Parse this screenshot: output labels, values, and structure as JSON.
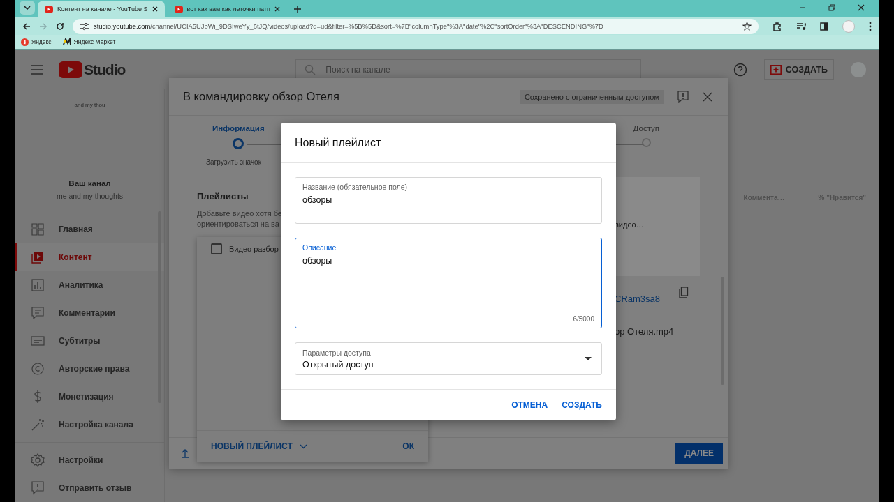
{
  "browser": {
    "tabs": [
      {
        "title": "Контент на канале - YouTube S",
        "selected": true
      },
      {
        "title": "вот как вам как леточки патп",
        "selected": false
      }
    ],
    "url_host": "studio.youtube.com",
    "url_path": "/channel/UCIA5UJbWi_9DSIweYy_6tJQ/videos/upload?d=ud&filter=%5B%5D&sort=%7B\"columnType\"%3A\"date\"%2C\"sortOrder\"%3A\"DESCENDING\"%7D",
    "bookmarks": [
      {
        "label": "Яндекс"
      },
      {
        "label": "Яндекс Маркет"
      }
    ]
  },
  "header": {
    "logo": "Studio",
    "search_placeholder": "Поиск на канале",
    "create_button": "СОЗДАТЬ"
  },
  "sidebar": {
    "channel_top": "and my thou",
    "channel_label": "Ваш канал",
    "channel_name": "me and my thoughts",
    "items": [
      {
        "label": "Главная",
        "selected": false
      },
      {
        "label": "Контент",
        "selected": true
      },
      {
        "label": "Аналитика",
        "selected": false
      },
      {
        "label": "Комментарии",
        "selected": false
      },
      {
        "label": "Субтитры",
        "selected": false
      },
      {
        "label": "Авторские права",
        "selected": false
      },
      {
        "label": "Монетизация",
        "selected": false
      },
      {
        "label": "Настройка канала",
        "selected": false
      }
    ],
    "bottom_items": [
      {
        "label": "Настройки"
      },
      {
        "label": "Отправить отзыв"
      }
    ]
  },
  "table": {
    "columns": [
      "Коммента…",
      "% \"Нравится\""
    ]
  },
  "upload_dialog": {
    "title": "В командировку обзор Отеля",
    "save_status": "Сохранено с ограниченным доступом",
    "steps": [
      {
        "label": "Информация",
        "selected": true
      },
      {
        "label": "Доступ",
        "selected": false
      }
    ],
    "upload_thumbnail": "Загрузить значок",
    "playlists_heading": "Плейлисты",
    "playlists_hint_lines": [
      "Добавьте видео хотя бе",
      "ориентироваться на ва"
    ],
    "preview_text": "видео…",
    "video_link": "CRam3sa8",
    "filename": "ор Отеля.mp4",
    "next_button": "ДАЛЕЕ"
  },
  "playlist_popover": {
    "items": [
      {
        "label": "Видео разбор",
        "checked": false
      }
    ],
    "new_button": "НОВЫЙ ПЛЕЙЛИСТ",
    "ok_button": "ОК"
  },
  "new_playlist_dialog": {
    "title": "Новый плейлист",
    "name_field": {
      "label": "Название (обязательное поле)",
      "value": "обзоры",
      "focused": false
    },
    "description_field": {
      "label": "Описание",
      "value": "обзоры",
      "counter": "6/5000",
      "focused": true
    },
    "visibility": {
      "label": "Параметры доступа",
      "value": "Открытый доступ"
    },
    "buttons": [
      "ОТМЕНА",
      "СОЗДАТЬ"
    ]
  }
}
